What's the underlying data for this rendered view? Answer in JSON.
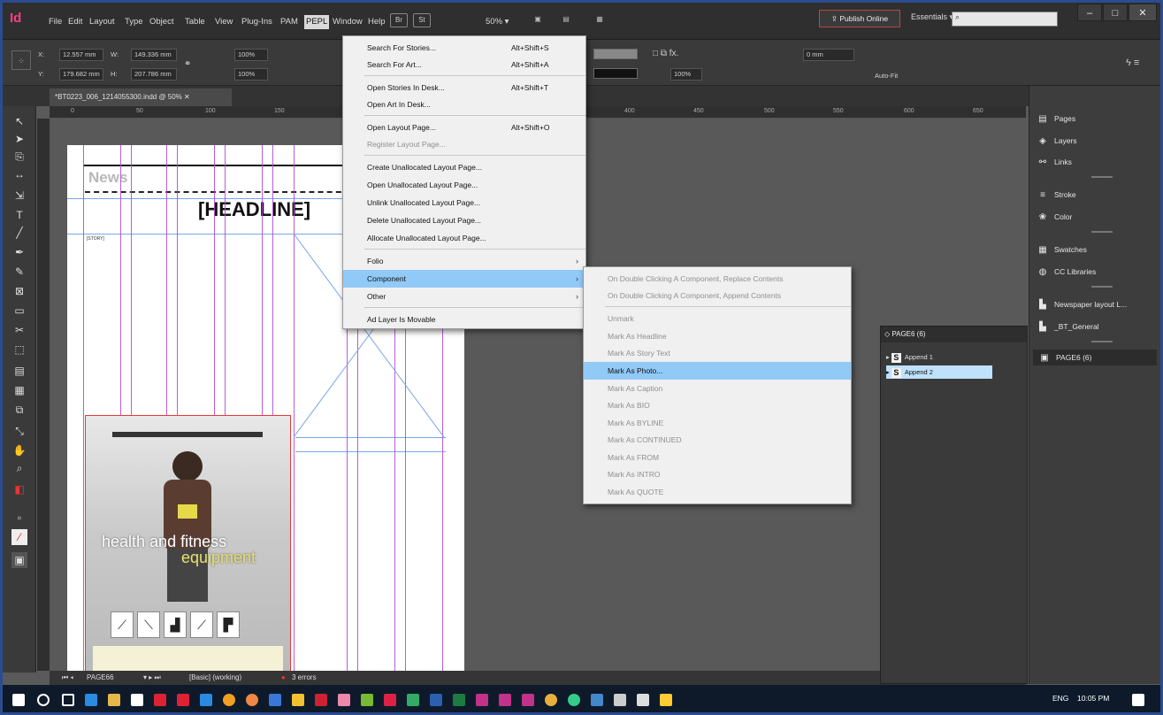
{
  "app": {
    "logo": "Id",
    "menu": [
      "File",
      "Edit",
      "Layout",
      "Type",
      "Object",
      "Table",
      "View",
      "Plug-Ins",
      "PAM",
      "PEPL",
      "Window",
      "Help"
    ],
    "bridge_chip": "Br",
    "stock_chip": "St",
    "zoom": "50%",
    "publish_label": "Publish Online",
    "essentials_label": "Essentials",
    "window_buttons": [
      "–",
      "□",
      "✕"
    ]
  },
  "control": {
    "x": "12.557 mm",
    "y": "179.682 mm",
    "w": "149.336 mm",
    "h": "207.786 mm",
    "scale_x": "100%",
    "scale_y": "100%",
    "stroke_pct": "100%",
    "offset": "0 mm",
    "autofit": "Auto-Fit",
    "labels": {
      "x": "X:",
      "y": "Y:",
      "w": "W:",
      "h": "H:"
    }
  },
  "document": {
    "tab_label": "*BT0223_006_1214055300.indd @ 50%",
    "ruler_ticks": [
      "0",
      "50",
      "100",
      "150",
      "400",
      "450",
      "500",
      "550",
      "600",
      "650"
    ],
    "news_label": "News",
    "headline": "[HEADLINE]",
    "small_label": "[STORY]",
    "photo_text_1": "health and fitness",
    "photo_text_2": "equipment"
  },
  "status": {
    "page": "PAGE66",
    "master": "[Basic] (working)",
    "errors": "3 errors"
  },
  "pepl_menu": {
    "items": [
      {
        "label": "Search For Stories...",
        "shortcut": "Alt+Shift+S",
        "enabled": true
      },
      {
        "label": "Search For Art...",
        "shortcut": "Alt+Shift+A",
        "enabled": true
      },
      {
        "label": "Open Stories In Desk...",
        "shortcut": "Alt+Shift+T",
        "enabled": true
      },
      {
        "label": "Open Art In Desk...",
        "shortcut": "",
        "enabled": true
      },
      {
        "label": "Open Layout Page...",
        "shortcut": "Alt+Shift+O",
        "enabled": true
      },
      {
        "label": "Register Layout Page...",
        "shortcut": "",
        "enabled": false
      },
      {
        "label": "Create Unallocated Layout Page...",
        "shortcut": "",
        "enabled": true
      },
      {
        "label": "Open Unallocated Layout Page...",
        "shortcut": "",
        "enabled": true
      },
      {
        "label": "Unlink Unallocated Layout Page...",
        "shortcut": "",
        "enabled": true
      },
      {
        "label": "Delete Unallocated Layout Page...",
        "shortcut": "",
        "enabled": true
      },
      {
        "label": "Allocate Unallocated Layout Page...",
        "shortcut": "",
        "enabled": true
      },
      {
        "label": "Folio",
        "shortcut": "",
        "enabled": true,
        "submenu": true
      },
      {
        "label": "Component",
        "shortcut": "",
        "enabled": true,
        "submenu": true,
        "highlighted": true
      },
      {
        "label": "Other",
        "shortcut": "",
        "enabled": true,
        "submenu": true
      },
      {
        "label": "Ad Layer Is Movable",
        "shortcut": "",
        "enabled": true
      }
    ]
  },
  "component_menu": {
    "items": [
      {
        "label": "On Double Clicking A Component, Replace Contents",
        "enabled": false
      },
      {
        "label": "On Double Clicking A Component, Append Contents",
        "enabled": false
      },
      {
        "label": "Unmark",
        "enabled": false
      },
      {
        "label": "Mark As Headline",
        "enabled": false
      },
      {
        "label": "Mark As Story Text",
        "enabled": false
      },
      {
        "label": "Mark As Photo...",
        "enabled": true,
        "highlighted": true
      },
      {
        "label": "Mark As Caption",
        "enabled": false
      },
      {
        "label": "Mark As BIO",
        "enabled": false
      },
      {
        "label": "Mark As BYLINE",
        "enabled": false
      },
      {
        "label": "Mark As CONTINUED",
        "enabled": false
      },
      {
        "label": "Mark As FROM",
        "enabled": false
      },
      {
        "label": "Mark As INTRO",
        "enabled": false
      },
      {
        "label": "Mark As QUOTE",
        "enabled": false
      }
    ]
  },
  "right_dock": {
    "items": [
      {
        "label": "Pages",
        "icon": "pages-icon"
      },
      {
        "label": "Layers",
        "icon": "layers-icon"
      },
      {
        "label": "Links",
        "icon": "links-icon"
      },
      {
        "label": "Stroke",
        "icon": "stroke-icon"
      },
      {
        "label": "Color",
        "icon": "color-icon"
      },
      {
        "label": "Swatches",
        "icon": "swatches-icon"
      },
      {
        "label": "CC Libraries",
        "icon": "cc-libraries-icon"
      },
      {
        "label": "Newspaper layout L...",
        "icon": "newspaper-icon"
      },
      {
        "label": "_BT_General",
        "icon": "general-icon"
      },
      {
        "label": "PAGE6 (6)",
        "icon": "page6-icon"
      }
    ]
  },
  "float_panel": {
    "title": "◇ PAGE6 (6)",
    "items": [
      "Append 1",
      "Append 2"
    ]
  },
  "taskbar": {
    "lang": "ENG",
    "time": "10:05 PM"
  }
}
